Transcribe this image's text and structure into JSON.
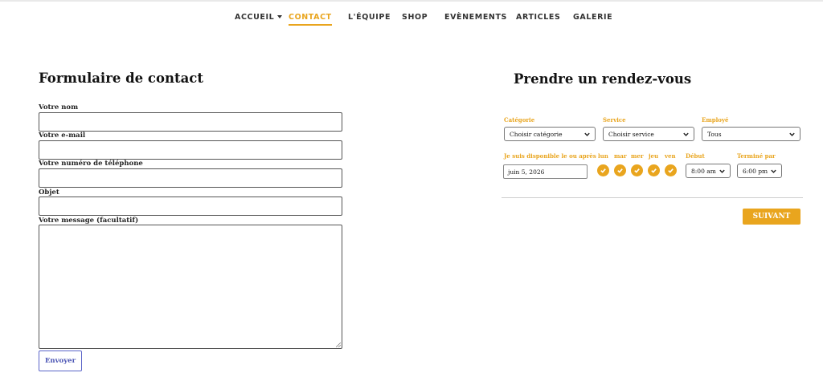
{
  "nav": {
    "items": [
      {
        "label": "ACCUEIL",
        "has_dropdown": true
      },
      {
        "label": "CONTACT",
        "active": true
      },
      {
        "label": "L'ÉQUIPE"
      },
      {
        "label": "SHOP"
      },
      {
        "label": "EVÈNEMENTS"
      },
      {
        "label": "ARTICLES"
      },
      {
        "label": "GALERIE"
      }
    ]
  },
  "contact": {
    "title": "Formulaire de contact",
    "fields": [
      {
        "label": "Votre nom",
        "value": ""
      },
      {
        "label": "Votre e-mail",
        "value": ""
      },
      {
        "label": "Votre numéro de téléphone",
        "value": ""
      },
      {
        "label": "Objet",
        "value": ""
      },
      {
        "label": "Votre message (facultatif)",
        "value": ""
      }
    ],
    "submit_label": "Envoyer"
  },
  "booking": {
    "title": "Prendre un rendez-vous",
    "category": {
      "label": "Catégorie",
      "selected": "Choisir catégorie"
    },
    "service": {
      "label": "Service",
      "selected": "Choisir service"
    },
    "employee": {
      "label": "Employé",
      "selected": "Tous"
    },
    "availability": {
      "label": "Je suis disponible le ou après",
      "date": "juin 5, 2026"
    },
    "days": [
      "lun",
      "mar",
      "mer",
      "jeu",
      "ven"
    ],
    "start": {
      "label": "Début",
      "selected": "8:00 am"
    },
    "end": {
      "label": "Terminé par",
      "selected": "6:00 pm"
    },
    "next_label": "SUIVANT"
  },
  "colors": {
    "accent": "#e9a51e",
    "button_outline": "#5a64c8"
  }
}
